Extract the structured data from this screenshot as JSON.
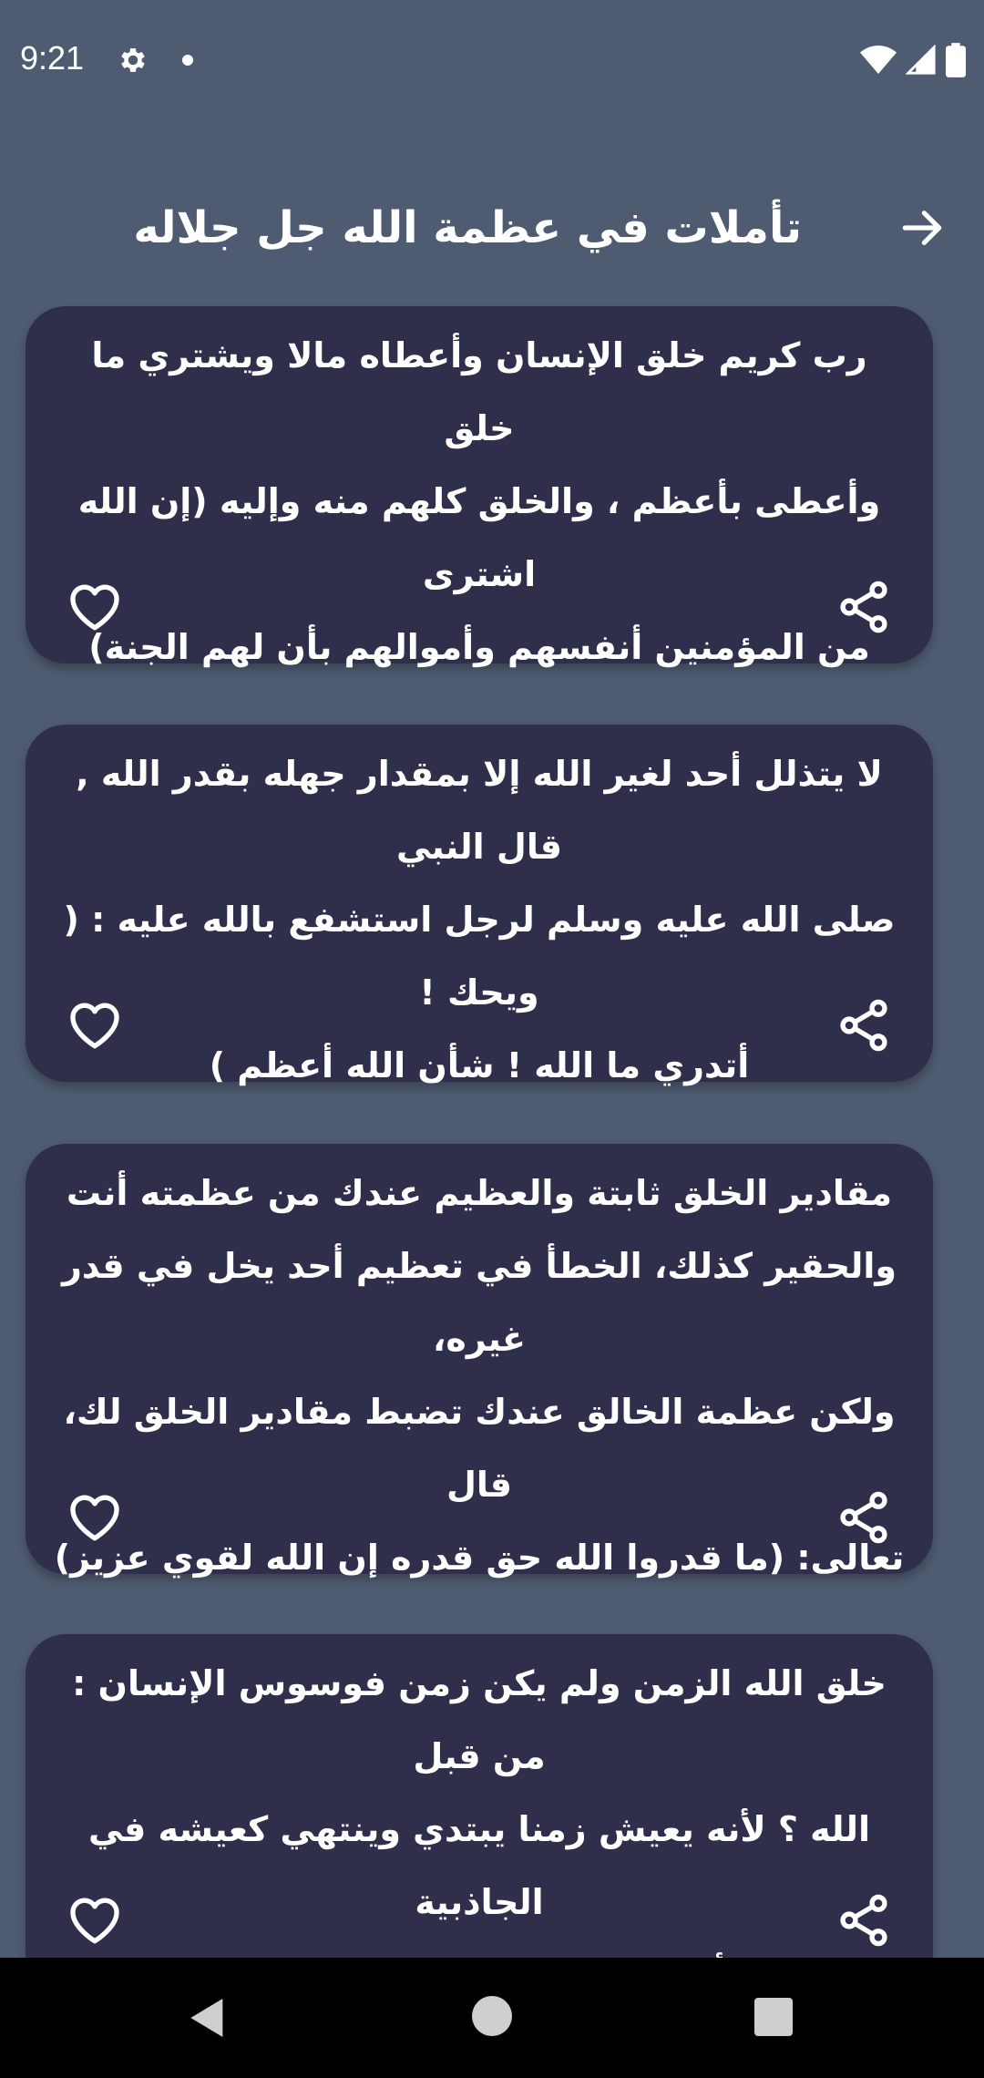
{
  "status_bar": {
    "time": "9:21",
    "icons": [
      "gear-icon",
      "notification-dot-icon",
      "wifi-icon",
      "signal-icon",
      "battery-icon"
    ]
  },
  "header": {
    "title": "تأملات في عظمة الله جل جلاله",
    "back_icon": "arrow-right-icon"
  },
  "quotes": [
    {
      "lines": [
        "رب كريم خلق الإنسان وأعطاه مالا ويشتري ما خلق",
        "وأعطى بأعظم ، والخلق كلهم منه وإليه (إن الله اشترى",
        "من المؤمنين أنفسهم وأموالهم بأن لهم الجنة)"
      ]
    },
    {
      "lines": [
        "لا يتذلل أحد لغير الله إلا بمقدار جهله بقدر الله , قال النبي",
        "صلى الله عليه وسلم لرجل استشفع بالله عليه : ( ويحك !",
        "أتدري ما الله ! شأن الله أعظم )"
      ]
    },
    {
      "lines": [
        "مقادير الخلق ثابتة والعظيم عندك من عظمته أنت",
        "والحقير كذلك، الخطأ في تعظيم أحد يخل في قدر غيره،",
        "ولكن عظمة الخالق عندك تضبط مقادير الخلق لك، قال",
        "تعالى: (ما قدروا الله حق قدره إن الله لقوي عزيز)"
      ]
    },
    {
      "lines": [
        "خلق الله الزمن ولم يكن زمن فوسوس الإنسان : من قبل",
        "الله ؟ لأنه يعيش زمنا يبتدي وينتهي كعيشه في الجاذبية",
        "فيظن أن كل ما في الكون مثله يسقط إلى الأسفل"
      ]
    }
  ],
  "card_icons": {
    "like": "heart-outline-icon",
    "share": "share-icon"
  },
  "colors": {
    "background": "#4e5b70",
    "card": "#2f2f4b",
    "text": "#ffffff",
    "nav_bar": "#000000"
  },
  "nav_bar": {
    "buttons": [
      "back-triangle-icon",
      "home-circle-icon",
      "recents-square-icon"
    ]
  }
}
